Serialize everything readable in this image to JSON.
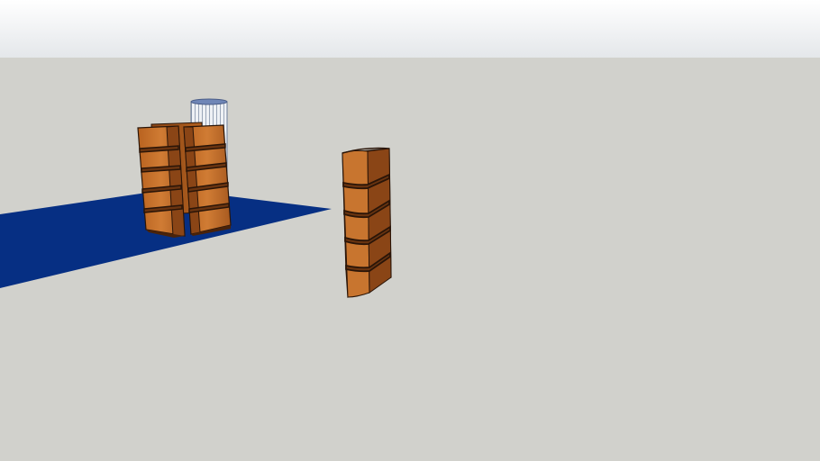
{
  "colors": {
    "sky_top": "#ffffff",
    "sky_bottom": "#e4e7ea",
    "ground": "#d1d1cc",
    "floor_plane": "#062f83",
    "wood_light": "#c8752f",
    "wood_mid": "#a95b20",
    "wood_dark": "#6a3410",
    "wood_shelf": "#8c4a18",
    "edge": "#2a1508",
    "cylinder": "#dfe4ec",
    "cylinder_cap": "#6f86b7"
  },
  "scene": {
    "objects": [
      "floor-plane",
      "glass-cylinder",
      "corner-shelf-back",
      "corner-shelf-left",
      "corner-shelf-right",
      "corner-shelf-standalone"
    ]
  }
}
